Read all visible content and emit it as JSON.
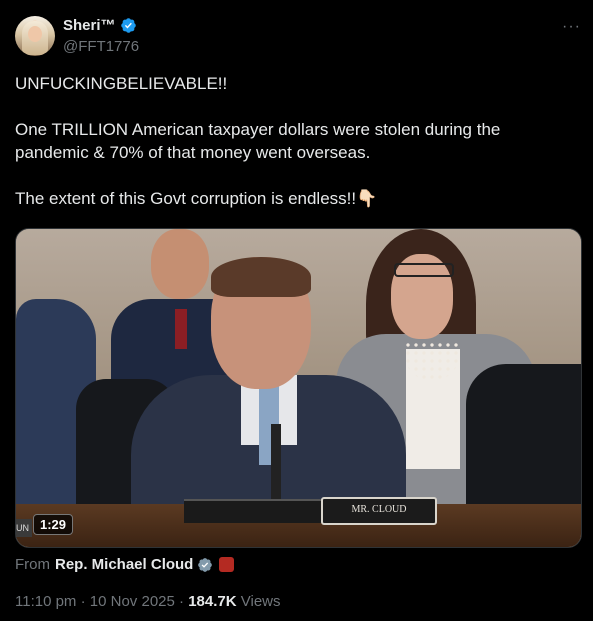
{
  "author": {
    "name": "Sheri™",
    "handle": "@FFT1776",
    "verified_color": "#1d9bf0"
  },
  "more_label": "···",
  "tweet": {
    "line1": "UNFUCKINGBELIEVABLE!!",
    "line2": "One TRILLION American taxpayer dollars were stolen during the pandemic & 70% of that money went overseas.",
    "line3": "The extent of this Govt corruption is endless!!👇🏻"
  },
  "media": {
    "nameplate": "MR. CLOUD",
    "duration": "1:29",
    "edge_text": "UN"
  },
  "source": {
    "from_label": "From",
    "name": "Rep. Michael Cloud"
  },
  "meta": {
    "time": "11:10 pm",
    "date": "10 Nov 2025",
    "views_count": "184.7K",
    "views_label": "Views",
    "separator": "·"
  }
}
